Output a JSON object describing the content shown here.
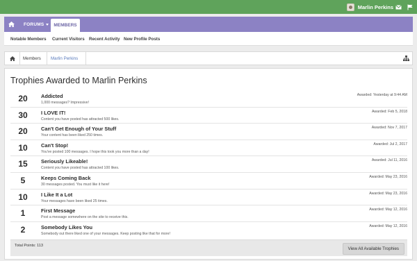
{
  "header": {
    "username": "Marlin Perkins",
    "icons": [
      "avatar",
      "envelope-icon",
      "flag-icon"
    ],
    "accent_color": "#5fa35b"
  },
  "nav": {
    "home_icon": "home-icon",
    "forums_label": "FORUMS",
    "members_label": "MEMBERS",
    "color": "#8c82c4"
  },
  "subnav": {
    "items": [
      {
        "label": "Notable Members"
      },
      {
        "label": "Current Visitors"
      },
      {
        "label": "Recent Activity"
      },
      {
        "label": "New Profile Posts"
      }
    ]
  },
  "breadcrumb": {
    "items": [
      {
        "label": "Members"
      },
      {
        "label": "Marlin Perkins"
      }
    ],
    "tree_icon": "sitemap-icon"
  },
  "main": {
    "title": "Trophies Awarded to Marlin Perkins",
    "trophies": [
      {
        "points": "20",
        "name": "Addicted",
        "description": "1,000 messages? Impressive!",
        "awarded": "Awarded: Yesterday at 9:44 AM"
      },
      {
        "points": "30",
        "name": "I LOVE IT!",
        "description": "Content you have posted has attracted 500 likes.",
        "awarded": "Awarded: Feb 5, 2018"
      },
      {
        "points": "20",
        "name": "Can't Get Enough of Your Stuff",
        "description": "Your content has been liked 250 times.",
        "awarded": "Awarded: Nov 7, 2017"
      },
      {
        "points": "10",
        "name": "Can't Stop!",
        "description": "You've posted 100 messages. I hope this took you more than a day!",
        "awarded": "Awarded: Jul 2, 2017"
      },
      {
        "points": "15",
        "name": "Seriously Likeable!",
        "description": "Content you have posted has attracted 100 likes.",
        "awarded": "Awarded: Jul 11, 2016"
      },
      {
        "points": "5",
        "name": "Keeps Coming Back",
        "description": "30 messages posted. You must like it here!",
        "awarded": "Awarded: May 23, 2016"
      },
      {
        "points": "10",
        "name": "I Like It a Lot",
        "description": "Your messages have been liked 25 times.",
        "awarded": "Awarded: May 23, 2016"
      },
      {
        "points": "1",
        "name": "First Message",
        "description": "Post a message somewhere on the site to receive this.",
        "awarded": "Awarded: May 12, 2016"
      },
      {
        "points": "2",
        "name": "Somebody Likes You",
        "description": "Somebody out there liked one of your messages. Keep posting like that for more!",
        "awarded": "Awarded: May 12, 2016"
      }
    ],
    "total_points": "Total Points: 113",
    "view_all_label": "View All Available Trophies"
  }
}
